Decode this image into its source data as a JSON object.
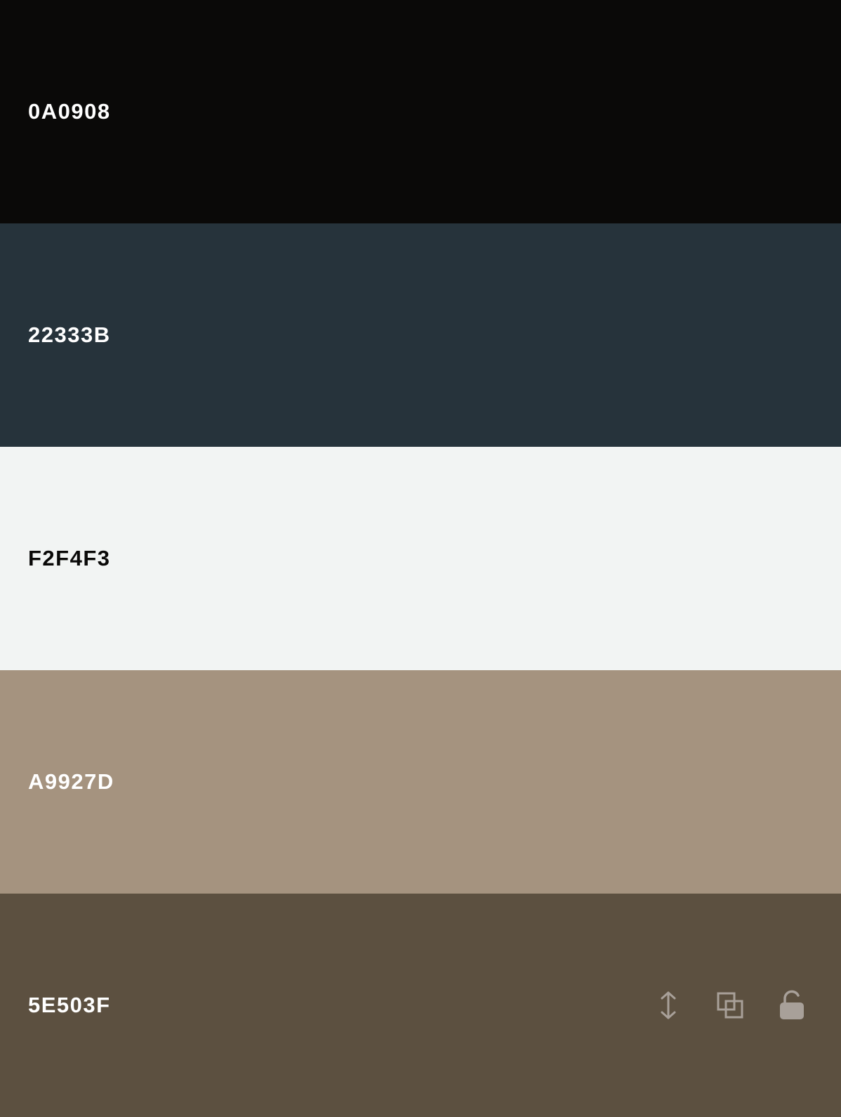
{
  "swatches": [
    {
      "hex": "0A0908",
      "color": "#0A0908",
      "text_color": "#FFFFFF"
    },
    {
      "hex": "22333B",
      "color": "#26333B",
      "text_color": "#FFFFFF"
    },
    {
      "hex": "F2F4F3",
      "color": "#F2F4F3",
      "text_color": "#0A0908"
    },
    {
      "hex": "A9927D",
      "color": "#A5937F",
      "text_color": "#FFFFFF"
    },
    {
      "hex": "5E503F",
      "color": "#5C5040",
      "text_color": "#FFFFFF"
    }
  ],
  "active_swatch_tools": {
    "icons": [
      "drag-vertical-icon",
      "copy-icon",
      "unlock-icon"
    ],
    "icon_color": "#A8A099"
  }
}
